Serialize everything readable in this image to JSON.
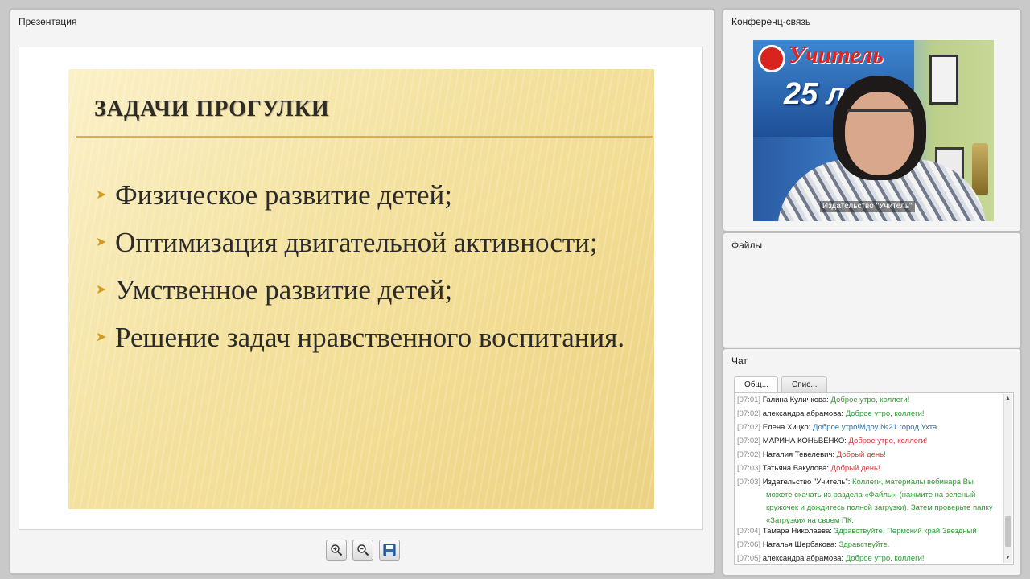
{
  "presentation": {
    "title": "Презентация",
    "slide": {
      "title": "ЗАДАЧИ ПРОГУЛКИ",
      "bullets": [
        "Физическое развитие детей;",
        "Оптимизация двигательной активности;",
        "Умственное развитие детей;",
        "Решение задач нравственного воспитания."
      ],
      "bullet_glyph": "➤"
    },
    "tools": [
      "zoom-in-icon",
      "zoom-out-icon",
      "save-icon"
    ]
  },
  "conference": {
    "title": "Конференц-связь",
    "video": {
      "caption": "Издательство \"Учитель\"",
      "banner_logo": "Учитель",
      "banner_big": "25 л"
    }
  },
  "files": {
    "title": "Файлы"
  },
  "chat": {
    "title": "Чат",
    "tabs": {
      "general": "Общ...",
      "list": "Спис..."
    },
    "colors": {
      "green": "#2e9b32",
      "red": "#d23a3a",
      "blue": "#2a6fb0"
    },
    "messages": [
      {
        "time": "[07:01]",
        "author": "Галина Куличкова:",
        "text": "Доброе утро, коллеги!",
        "color": "green"
      },
      {
        "time": "[07:02]",
        "author": "александра абрамова:",
        "text": "Доброе утро, коллеги!",
        "color": "green"
      },
      {
        "time": "[07:02]",
        "author": "Елена Хицко:",
        "text": "Доброе утро!Мдоу №21 город Ухта",
        "color": "blue"
      },
      {
        "time": "[07:02]",
        "author": "МАРИНА КОНЬВЕНКО:",
        "text": "Доброе утро, коллеги!",
        "color": "red"
      },
      {
        "time": "[07:02]",
        "author": "Наталия Тевелевич:",
        "text": "Добрый день!",
        "color": "red"
      },
      {
        "time": "[07:03]",
        "author": "Татьяна Вакулова:",
        "text": "Добрый день!",
        "color": "red"
      },
      {
        "time": "[07:03]",
        "author": "Издательство \"Учитель\":",
        "text": "Коллеги, материалы вебинара Вы",
        "text2": "можете скачать из раздела «Файлы» (нажмите на зеленый кружочек и дождитесь полной загрузки). Затем проверьте папку «Загрузки» на своем ПК.",
        "color": "green"
      },
      {
        "time": "[07:04]",
        "author": "Тамара Николаева:",
        "text": "Здравствуйте, Пермский край Звездный",
        "color": "green"
      },
      {
        "time": "[07:06]",
        "author": "Наталья Щербакова:",
        "text": "Здравствуйте.",
        "color": "green"
      },
      {
        "time": "[07:05]",
        "author": "александра абрамова:",
        "text": "Доброе утро, коллеги!",
        "color": "green"
      }
    ]
  }
}
